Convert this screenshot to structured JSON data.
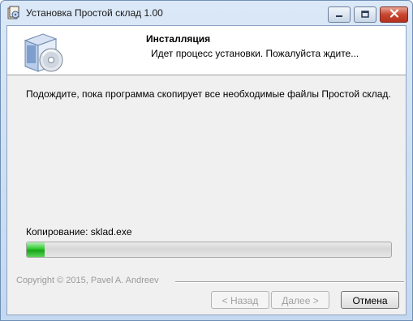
{
  "window": {
    "title": "Установка Простой склад 1.00"
  },
  "header": {
    "title": "Инсталляция",
    "subtitle": "Идет процесс установки. Пожалуйста ждите..."
  },
  "body": {
    "message": "Подождите, пока программа скопирует все необходимые файлы Простой склад.",
    "status": "Копирование: sklad.exe",
    "progress_fraction": 0.05
  },
  "footer": {
    "copyright": "Copyright © 2015, Pavel A. Andreev",
    "back_label": "< Назад",
    "next_label": "Далее >",
    "cancel_label": "Отмена"
  },
  "icons": {
    "app": "installer-app-icon",
    "header_graphic": "software-box-cd-icon",
    "minimize": "minimize-icon",
    "maximize": "maximize-icon",
    "close": "close-icon"
  },
  "colors": {
    "progress_fill": "#2ec82e",
    "close_button": "#c8452f"
  }
}
